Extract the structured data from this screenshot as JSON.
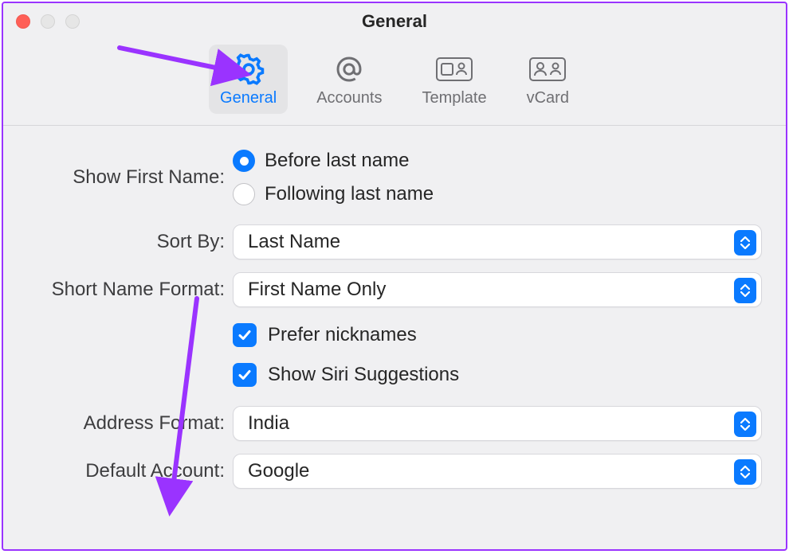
{
  "window": {
    "title": "General"
  },
  "tabs": {
    "general": {
      "label": "General"
    },
    "accounts": {
      "label": "Accounts"
    },
    "template": {
      "label": "Template"
    },
    "vcard": {
      "label": "vCard"
    }
  },
  "labels": {
    "show_first_name": "Show First Name:",
    "sort_by": "Sort By:",
    "short_name_format": "Short Name Format:",
    "address_format": "Address Format:",
    "default_account": "Default Account:"
  },
  "show_first_name": {
    "before": {
      "label": "Before last name",
      "checked": true
    },
    "following": {
      "label": "Following last name",
      "checked": false
    }
  },
  "sort_by": {
    "value": "Last Name"
  },
  "short_name_format": {
    "value": "First Name Only"
  },
  "prefer_nicknames": {
    "label": "Prefer nicknames",
    "checked": true
  },
  "show_siri": {
    "label": "Show Siri Suggestions",
    "checked": true
  },
  "address_format": {
    "value": "India"
  },
  "default_account": {
    "value": "Google"
  }
}
